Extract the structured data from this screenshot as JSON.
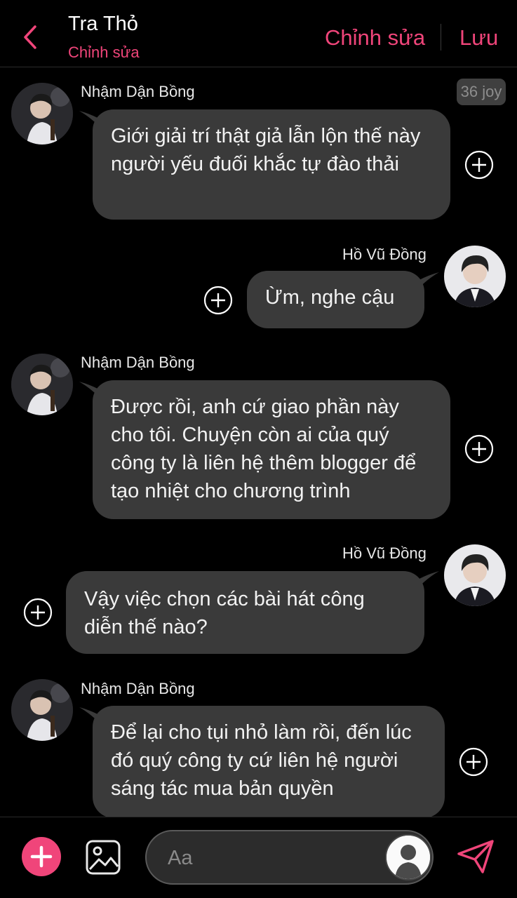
{
  "header": {
    "back_icon": "chevron-left-icon",
    "title": "Tra Thỏ",
    "subtitle": "Chỉnh sửa",
    "edit_label": "Chỉnh sửa",
    "save_label": "Lưu",
    "accent_color": "#f0457a"
  },
  "badge": {
    "text": "36 joy"
  },
  "messages": [
    {
      "sender": "Nhậm Dận Bồng",
      "side": "left",
      "text": "Giới giải trí thật giả lẫn lộn thế này người yếu đuối khắc tự đào thải"
    },
    {
      "sender": "Hồ Vũ Đồng",
      "side": "right",
      "text": "Ừm, nghe cậu"
    },
    {
      "sender": "Nhậm Dận Bồng",
      "side": "left",
      "text": "Được rồi, anh cứ giao phần này cho tôi. Chuyện còn ai của quý công ty là liên hệ thêm blogger để tạo nhiệt cho chương trình"
    },
    {
      "sender": "Hồ Vũ Đồng",
      "side": "right",
      "text": "Vậy việc chọn các bài hát công diễn thế nào?"
    },
    {
      "sender": "Nhậm Dận Bồng",
      "side": "left",
      "text": "Để lại cho tụi nhỏ làm rồi, đến lúc đó quý công ty cứ liên hệ người sáng tác mua bản quyền"
    }
  ],
  "composer": {
    "placeholder": "Aa",
    "add_icon": "plus-icon",
    "image_icon": "image-icon",
    "send_icon": "send-icon"
  }
}
